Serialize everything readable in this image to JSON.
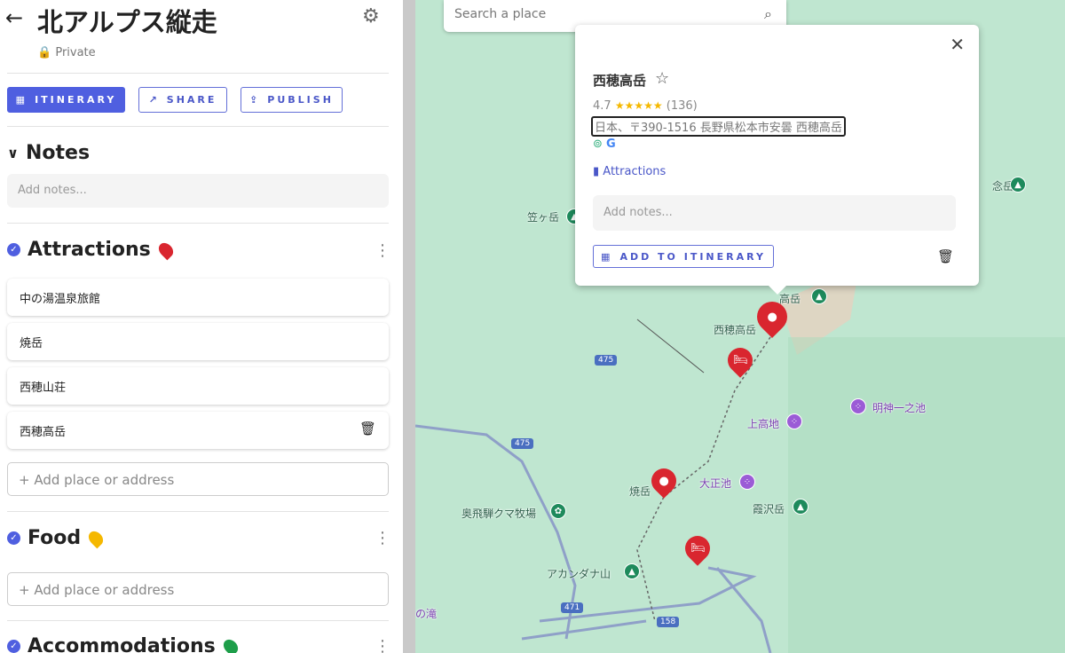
{
  "trip": {
    "title": "北アルプス縦走",
    "visibility": "Private"
  },
  "toolbar": {
    "itinerary": "ITINERARY",
    "share": "SHARE",
    "publish": "PUBLISH"
  },
  "notes": {
    "heading": "Notes",
    "placeholder": "Add notes..."
  },
  "sections": [
    {
      "name": "Attractions",
      "pin_color": "#d9262f",
      "items": [
        "中の湯温泉旅館",
        "焼岳",
        "西穂山荘",
        "西穂高岳"
      ],
      "add": "+ Add place or address"
    },
    {
      "name": "Food",
      "pin_color": "#f5b800",
      "items": [],
      "add": "+ Add place or address"
    },
    {
      "name": "Accommodations",
      "pin_color": "#1e9e4a"
    }
  ],
  "search": {
    "placeholder": "Search a place"
  },
  "popup": {
    "name": "西穂高岳",
    "rating": "4.7",
    "reviews": "(136)",
    "stars": 4.7,
    "address": "日本、〒390-1516 長野県松本市安曇 西穂高岳",
    "category": "Attractions",
    "notes_placeholder": "Add notes...",
    "add_itinerary": "ADD TO ITINERARY"
  },
  "map": {
    "labels": {
      "kasagatake": "笠ヶ岳",
      "jonen": "念岳",
      "okuhotaka": "高岳",
      "nishihotaka": "西穂高岳",
      "kamikochi": "上高地",
      "myojin": "明神一之池",
      "taisho": "大正池",
      "kasumizawa": "霞沢岳",
      "yakedake": "焼岳",
      "kuma": "奥飛騨クマ牧場",
      "akandana": "アカンダナ山",
      "taki": "の滝"
    },
    "roads": [
      "475",
      "475",
      "471",
      "158"
    ]
  },
  "colors": {
    "accent": "#4f5fe0",
    "marker": "#d9262f"
  }
}
